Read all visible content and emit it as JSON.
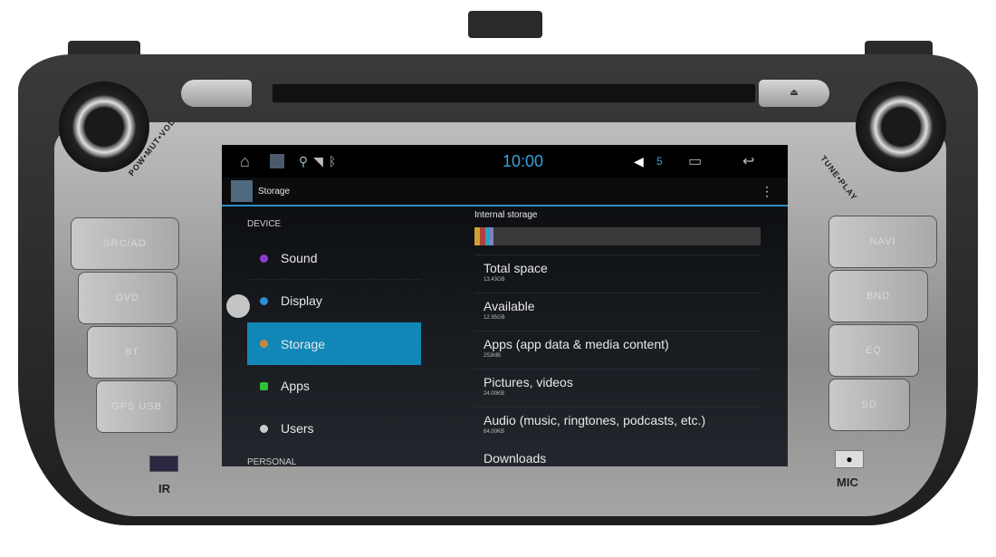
{
  "device": {
    "knob_left_label": "POW•MUT•VOL",
    "knob_right_label": "TUNE•PLAY",
    "left_keys": [
      "SRC/AD",
      "DVD",
      "BT",
      "GPS USB"
    ],
    "right_keys": [
      "NAVI",
      "BND",
      "EQ",
      "SD"
    ],
    "ir_label": "IR",
    "mic_label": "MIC"
  },
  "status_bar": {
    "time": "10:00",
    "volume": "5"
  },
  "action_bar": {
    "title": "Storage"
  },
  "sidebar": {
    "header": "DEVICE",
    "items": [
      {
        "label": "Sound",
        "icon": "sound-icon",
        "color": "#8e3ccf"
      },
      {
        "label": "Display",
        "icon": "display-icon",
        "color": "#2a8fd0"
      },
      {
        "label": "Storage",
        "icon": "storage-icon",
        "color": "#c7883a",
        "selected": true
      },
      {
        "label": "Apps",
        "icon": "apps-icon",
        "color": "#2fbf3a"
      },
      {
        "label": "Users",
        "icon": "users-icon",
        "color": "#cccccc"
      }
    ],
    "next_header": "PERSONAL"
  },
  "storage": {
    "title": "Internal storage",
    "usage_segments": [
      "#d0a030",
      "#b04040",
      "#30a0c0",
      "#8080c0"
    ],
    "rows": [
      {
        "title": "Total space",
        "value": "13.43GB"
      },
      {
        "title": "Available",
        "value": "12.95GB"
      },
      {
        "title": "Apps (app data & media content)",
        "value": "253MB"
      },
      {
        "title": "Pictures, videos",
        "value": "24.00KB"
      },
      {
        "title": "Audio (music, ringtones, podcasts, etc.)",
        "value": "64.00KB"
      },
      {
        "title": "Downloads",
        "value": ""
      }
    ]
  },
  "colors": {
    "accent": "#1187b8",
    "clock": "#3aa0d8"
  }
}
